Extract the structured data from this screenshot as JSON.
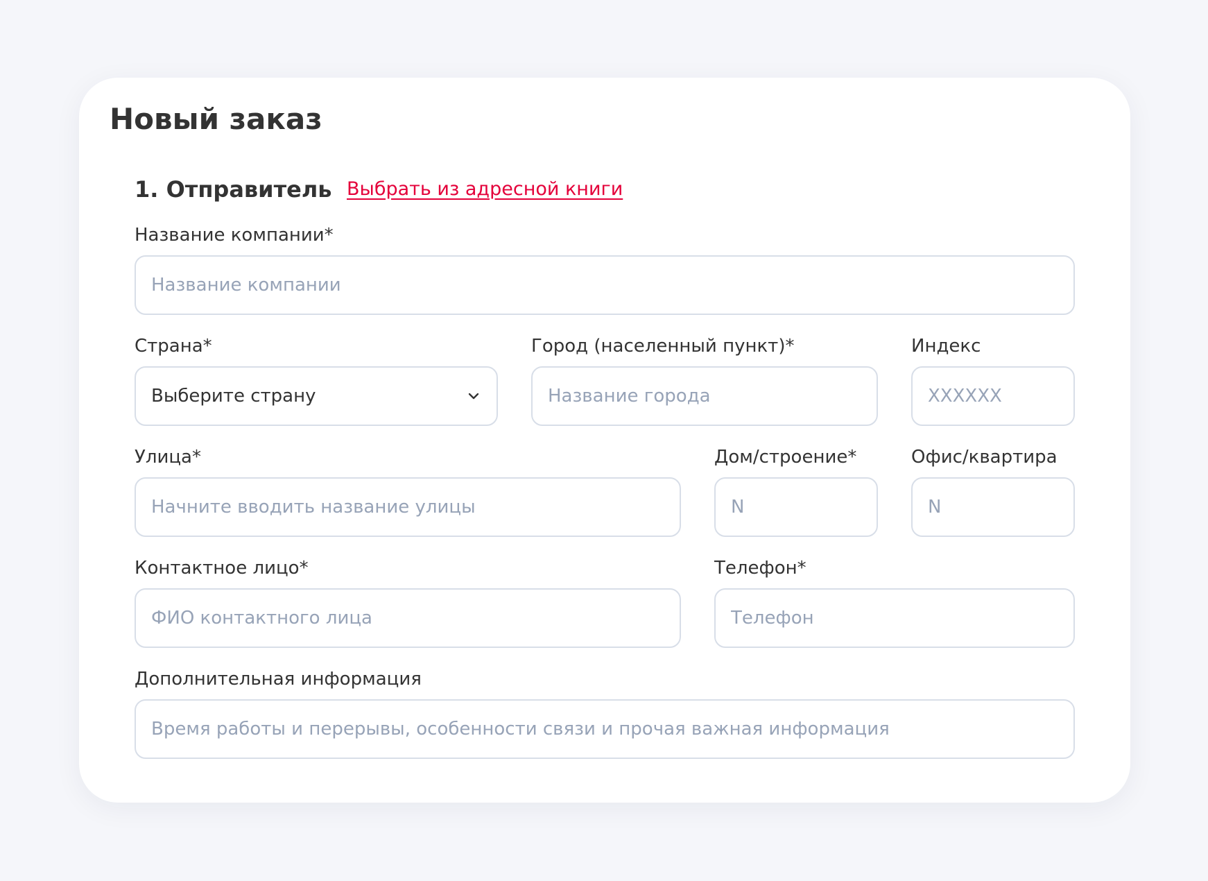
{
  "page": {
    "title": "Новый заказ"
  },
  "section": {
    "title": "1. Отправитель",
    "address_book_link": "Выбрать из адресной книги"
  },
  "fields": {
    "company": {
      "label": "Название компании*",
      "placeholder": "Название компании",
      "value": ""
    },
    "country": {
      "label": "Страна*",
      "value": "Выберите страну",
      "icon": "chevron-down-icon"
    },
    "city": {
      "label": "Город (населенный пункт)*",
      "placeholder": "Название города",
      "value": ""
    },
    "zip": {
      "label": "Индекс",
      "placeholder": "XXXXXX",
      "value": ""
    },
    "street": {
      "label": "Улица*",
      "placeholder": "Начните вводить название улицы",
      "value": ""
    },
    "house": {
      "label": "Дом/строение*",
      "placeholder": "N",
      "value": ""
    },
    "office": {
      "label": "Офис/квартира",
      "placeholder": "N",
      "value": ""
    },
    "contact": {
      "label": "Контактное лицо*",
      "placeholder": "ФИО контактного лица",
      "value": ""
    },
    "phone": {
      "label": "Телефон*",
      "placeholder": "Телефон",
      "value": ""
    },
    "info": {
      "label": "Дополнительная информация",
      "placeholder": "Время работы и перерывы, особенности связи и прочая важная информация",
      "value": ""
    }
  },
  "colors": {
    "background": "#f5f6fa",
    "card": "#ffffff",
    "link": "#e4003a",
    "input_border": "#d8dee8",
    "placeholder": "#97a3b7",
    "text": "#333333"
  }
}
